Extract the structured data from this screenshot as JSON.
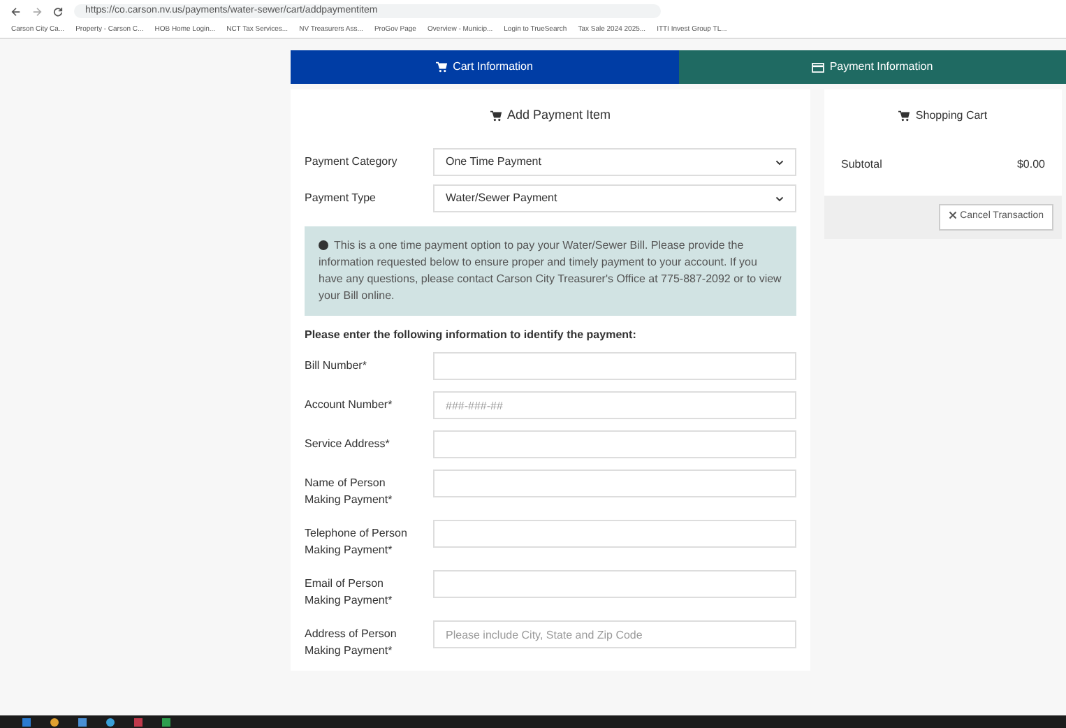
{
  "browser": {
    "url": "https://co.carson.nv.us/payments/water-sewer/cart/addpaymentitem",
    "bookmarks": [
      "Carson City Ca...",
      "Property - Carson C...",
      "HOB Home Login...",
      "NCT Tax Services...",
      "NV Treasurers Ass...",
      "ProGov Page",
      "Overview - Municip...",
      "Login to TrueSearch",
      "Tax Sale 2024 2025...",
      "ITTI Invest Group TL..."
    ]
  },
  "tabs": [
    {
      "label": "Cart Information",
      "selected": true
    },
    {
      "label": "Payment Information",
      "selected": false
    }
  ],
  "add_item": {
    "title": "Add Payment Item",
    "selects": [
      {
        "label": "Payment Category",
        "value": "One Time Payment"
      },
      {
        "label": "Payment Type",
        "value": "Water/Sewer Payment"
      }
    ],
    "notice": "This is a one time payment option to pay your Water/Sewer Bill. Please provide the information requested below to ensure proper and timely payment to your account. If you have any questions, please contact Carson City Treasurer's Office at 775-887-2092 or to view your Bill online.",
    "instructions": "Please enter the following information to identify the payment:",
    "fields": [
      {
        "label": "Bill Number*"
      },
      {
        "label": "Account Number*",
        "placeholder": "###-###-##"
      },
      {
        "label": "Service Address*"
      },
      {
        "label": "Name of Person Making Payment*"
      },
      {
        "label": "Telephone of Person Making Payment*"
      },
      {
        "label": "Email of Person Making Payment*"
      },
      {
        "label": "Address of Person Making Payment*",
        "placeholder": "Please include City, State and Zip Code"
      }
    ]
  },
  "cart": {
    "title": "Shopping Cart",
    "subtotal_label": "Subtotal",
    "subtotal": "$0.00",
    "cancel_button": "Cancel Transaction"
  }
}
